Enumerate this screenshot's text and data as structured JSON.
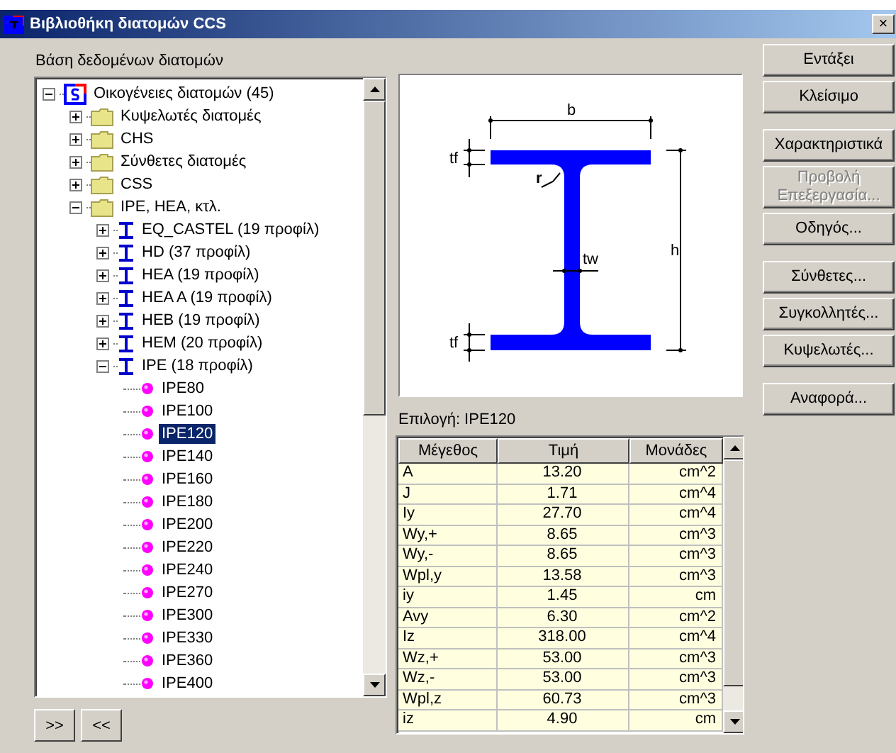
{
  "window": {
    "title": "Βιβλιοθήκη διατομών CCS",
    "close": "×"
  },
  "tree_label": "Βάση δεδομένων διατομών",
  "tree": [
    {
      "label": "Οικογένειες διατομών (45)",
      "kind": "root",
      "expanded": true,
      "selected": false,
      "children": [
        {
          "label": "Κυψελωτές διατομές",
          "kind": "folder",
          "expanded": false,
          "selected": false
        },
        {
          "label": "CHS",
          "kind": "folder",
          "expanded": false,
          "selected": false
        },
        {
          "label": "Σύνθετες διατομές",
          "kind": "folder",
          "expanded": false,
          "selected": false
        },
        {
          "label": "CSS",
          "kind": "folder",
          "expanded": false,
          "selected": false
        },
        {
          "label": "IPE, HEA, κτλ.",
          "kind": "folder",
          "expanded": true,
          "selected": false,
          "children": [
            {
              "label": "EQ_CASTEL (19 προφίλ)",
              "kind": "family",
              "expanded": false,
              "selected": false
            },
            {
              "label": "HD (37 προφίλ)",
              "kind": "family",
              "expanded": false,
              "selected": false
            },
            {
              "label": "HEA (19 προφίλ)",
              "kind": "family",
              "expanded": false,
              "selected": false
            },
            {
              "label": "HEA A (19 προφίλ)",
              "kind": "family",
              "expanded": false,
              "selected": false
            },
            {
              "label": "HEB (19 προφίλ)",
              "kind": "family",
              "expanded": false,
              "selected": false
            },
            {
              "label": "HEM (20 προφίλ)",
              "kind": "family",
              "expanded": false,
              "selected": false
            },
            {
              "label": "IPE (18 προφίλ)",
              "kind": "family",
              "expanded": true,
              "selected": false,
              "children": [
                {
                  "label": "IPE80",
                  "kind": "section",
                  "selected": false
                },
                {
                  "label": "IPE100",
                  "kind": "section",
                  "selected": false
                },
                {
                  "label": "IPE120",
                  "kind": "section",
                  "selected": true
                },
                {
                  "label": "IPE140",
                  "kind": "section",
                  "selected": false
                },
                {
                  "label": "IPE160",
                  "kind": "section",
                  "selected": false
                },
                {
                  "label": "IPE180",
                  "kind": "section",
                  "selected": false
                },
                {
                  "label": "IPE200",
                  "kind": "section",
                  "selected": false
                },
                {
                  "label": "IPE220",
                  "kind": "section",
                  "selected": false
                },
                {
                  "label": "IPE240",
                  "kind": "section",
                  "selected": false
                },
                {
                  "label": "IPE270",
                  "kind": "section",
                  "selected": false
                },
                {
                  "label": "IPE300",
                  "kind": "section",
                  "selected": false
                },
                {
                  "label": "IPE330",
                  "kind": "section",
                  "selected": false
                },
                {
                  "label": "IPE360",
                  "kind": "section",
                  "selected": false
                },
                {
                  "label": "IPE400",
                  "kind": "section",
                  "selected": false
                }
              ]
            }
          ]
        }
      ]
    }
  ],
  "nav_buttons": [
    ">>",
    "<<"
  ],
  "diagram": {
    "width": "b",
    "flange_top": "tf",
    "radius": "r",
    "height": "h",
    "web": "tw",
    "flange_bottom": "tf"
  },
  "selection": "Επιλογή: IPE120",
  "table": {
    "columns": [
      "Μέγεθος",
      "Τιμή",
      "Μονάδες"
    ],
    "rows": [
      [
        "A",
        "13.20",
        "cm^2"
      ],
      [
        "J",
        "1.71",
        "cm^4"
      ],
      [
        "Iy",
        "27.70",
        "cm^4"
      ],
      [
        "Wy,+",
        "8.65",
        "cm^3"
      ],
      [
        "Wy,-",
        "8.65",
        "cm^3"
      ],
      [
        "Wpl,y",
        "13.58",
        "cm^3"
      ],
      [
        "iy",
        "1.45",
        "cm"
      ],
      [
        "Avy",
        "6.30",
        "cm^2"
      ],
      [
        "Iz",
        "318.00",
        "cm^4"
      ],
      [
        "Wz,+",
        "53.00",
        "cm^3"
      ],
      [
        "Wz,-",
        "53.00",
        "cm^3"
      ],
      [
        "Wpl,z",
        "60.73",
        "cm^3"
      ],
      [
        "iz",
        "4.90",
        "cm"
      ]
    ]
  },
  "button_groups": [
    [
      {
        "label": "Εντάξει",
        "disabled": false
      },
      {
        "label": "Κλείσιμο",
        "disabled": false
      }
    ],
    [
      {
        "label": "Χαρακτηριστικά",
        "disabled": false
      },
      {
        "label": "Προβολή Επεξεργασία...",
        "disabled": true
      },
      {
        "label": "Οδηγός...",
        "disabled": false
      }
    ],
    [
      {
        "label": "Σύνθετες...",
        "disabled": false
      },
      {
        "label": "Συγκολλητές...",
        "disabled": false
      },
      {
        "label": "Κυψελωτές...",
        "disabled": false
      }
    ],
    [
      {
        "label": "Αναφορά...",
        "disabled": false
      }
    ]
  ]
}
